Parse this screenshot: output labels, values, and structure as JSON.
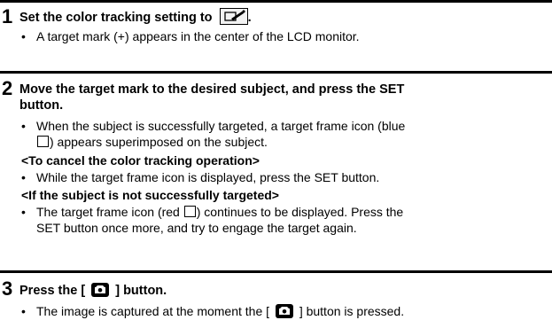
{
  "steps": [
    {
      "number": "1",
      "title_pre": "Set the color tracking setting to",
      "title_post": ".",
      "bullets": [
        "A target mark (+) appears in the center of the LCD monitor."
      ]
    },
    {
      "number": "2",
      "title_line1": "Move the target mark to the desired subject, and press the SET",
      "title_line2": "button.",
      "bullet1_line1": "When the subject is successfully targeted, a target frame icon (blue",
      "bullet1_line2_post": ") appears superimposed on the subject.",
      "sub1": "<To cancel the color tracking operation>",
      "bullet2": "While the target frame icon is displayed, press the SET button.",
      "sub2": "<If the subject is not successfully targeted>",
      "bullet3_line1_pre": "The target frame icon (red",
      "bullet3_line1_post": ") continues to be displayed. Press the",
      "bullet3_line2": "SET button once more, and try to engage the target again."
    },
    {
      "number": "3",
      "title_pre": "Press the [",
      "title_post": "] button.",
      "bullet1_pre": "The image is captured at the moment the [",
      "bullet1_post": "] button is pressed."
    }
  ],
  "bullet_char": "•",
  "icons": {
    "tracking": "color-tracking-icon",
    "camera": "camera-shutter-icon",
    "square": "square-frame-icon"
  }
}
